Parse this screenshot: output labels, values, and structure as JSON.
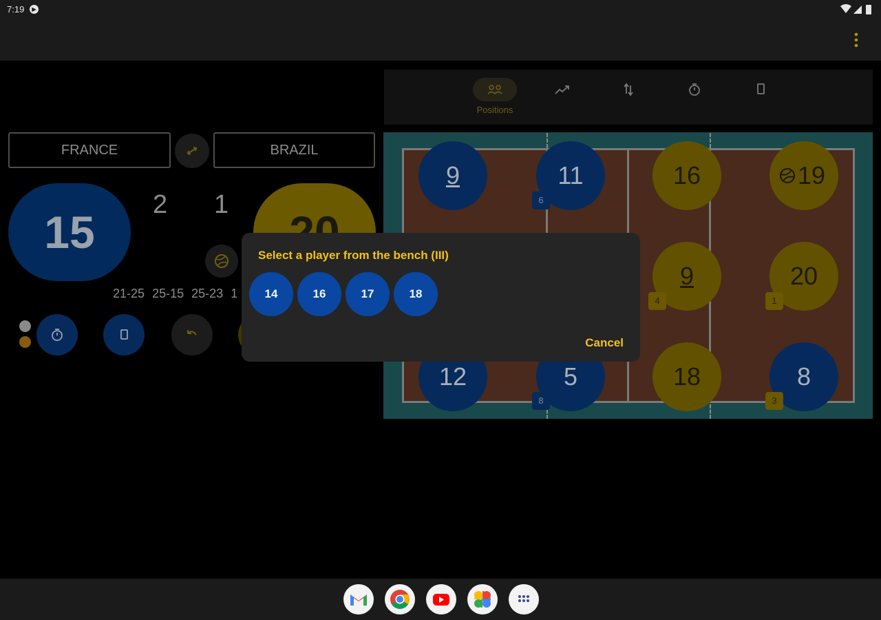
{
  "status_bar": {
    "time": "7:19",
    "notification_icon": "media-notification-icon",
    "wifi_icon": "wifi-icon",
    "signal_icon": "cell-signal-icon",
    "battery_icon": "battery-icon"
  },
  "app_bar": {
    "overflow_icon": "more-vert-icon"
  },
  "scoreboard": {
    "home_team": "FRANCE",
    "away_team": "BRAZIL",
    "swap_icon": "swap-sides-icon",
    "home_points": "15",
    "away_points": "20",
    "home_sets": "2",
    "away_sets": "1",
    "serve_icon": "volleyball-icon",
    "set_scores": [
      "21-25",
      "25-15",
      "25-23",
      "1"
    ],
    "actions": [
      {
        "name": "timeout-button",
        "icon": "timer-icon"
      },
      {
        "name": "substitution-button",
        "icon": "card-icon"
      },
      {
        "name": "undo-button",
        "icon": "undo-icon"
      }
    ]
  },
  "tabs": [
    {
      "label": "Positions",
      "icon": "positions-icon",
      "active": true
    },
    {
      "label": "",
      "icon": "statistics-icon",
      "active": false
    },
    {
      "label": "",
      "icon": "substitutions-icon",
      "active": false
    },
    {
      "label": "",
      "icon": "timer-icon",
      "active": false
    },
    {
      "label": "",
      "icon": "card-icon",
      "active": false
    }
  ],
  "court": {
    "players": [
      {
        "number": "9",
        "team": "home",
        "captain": true
      },
      {
        "number": "11",
        "team": "home",
        "badge": "6"
      },
      {
        "number": "16",
        "team": "away"
      },
      {
        "number": "19",
        "team": "away",
        "serving": true
      },
      {
        "number": "9",
        "team": "away",
        "captain": true,
        "badge": "4"
      },
      {
        "number": "20",
        "team": "away",
        "badge": "1"
      },
      {
        "number": "12",
        "team": "home"
      },
      {
        "number": "5",
        "team": "home",
        "badge": "8"
      },
      {
        "number": "18",
        "team": "away"
      },
      {
        "number": "8",
        "team": "home",
        "badge": "3"
      }
    ]
  },
  "dialog": {
    "title": "Select a player from the bench (III)",
    "bench": [
      "14",
      "16",
      "17",
      "18"
    ],
    "cancel": "Cancel"
  },
  "colors": {
    "accent": "#f2c21a",
    "home": "#062a5c",
    "away": "#625200",
    "bench": "#0a47a3"
  },
  "dock": [
    "gmail-icon",
    "chrome-icon",
    "youtube-icon",
    "photos-icon",
    "app-drawer-icon"
  ]
}
